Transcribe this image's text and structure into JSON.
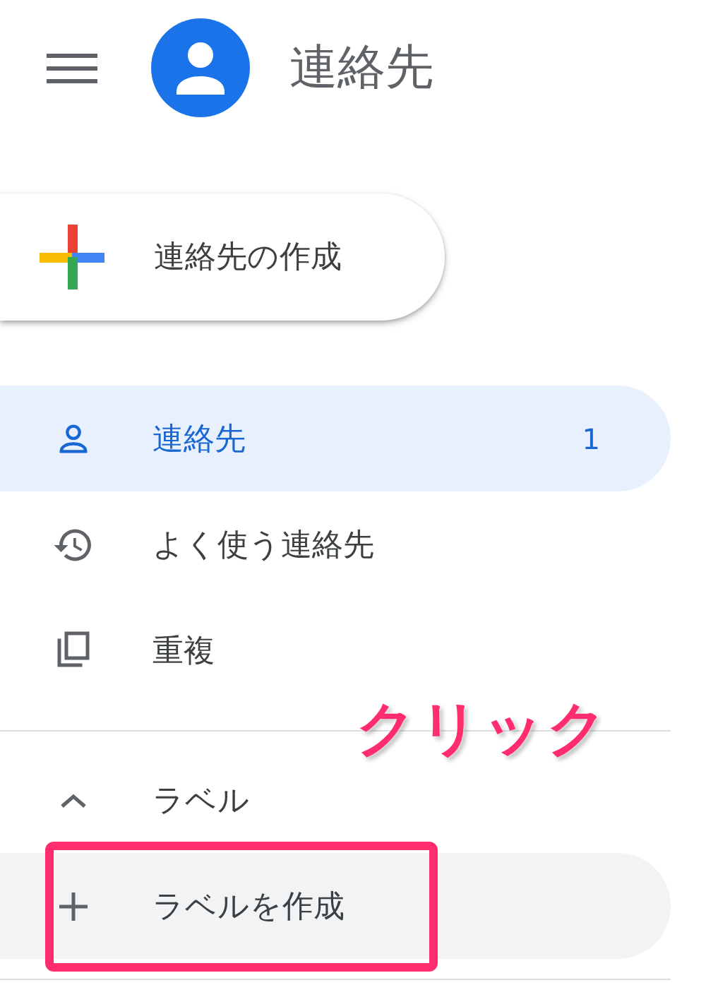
{
  "header": {
    "title": "連絡先"
  },
  "create_button": {
    "label": "連絡先の作成"
  },
  "nav": [
    {
      "label": "連絡先",
      "count": "1",
      "selected": true
    },
    {
      "label": "よく使う連絡先",
      "selected": false
    },
    {
      "label": "重複",
      "selected": false
    }
  ],
  "labels": {
    "title": "ラベル",
    "expanded": true,
    "items": [
      {
        "label": "ラベルを作成",
        "hovered": true
      }
    ]
  },
  "annotation": {
    "text": "クリック"
  }
}
